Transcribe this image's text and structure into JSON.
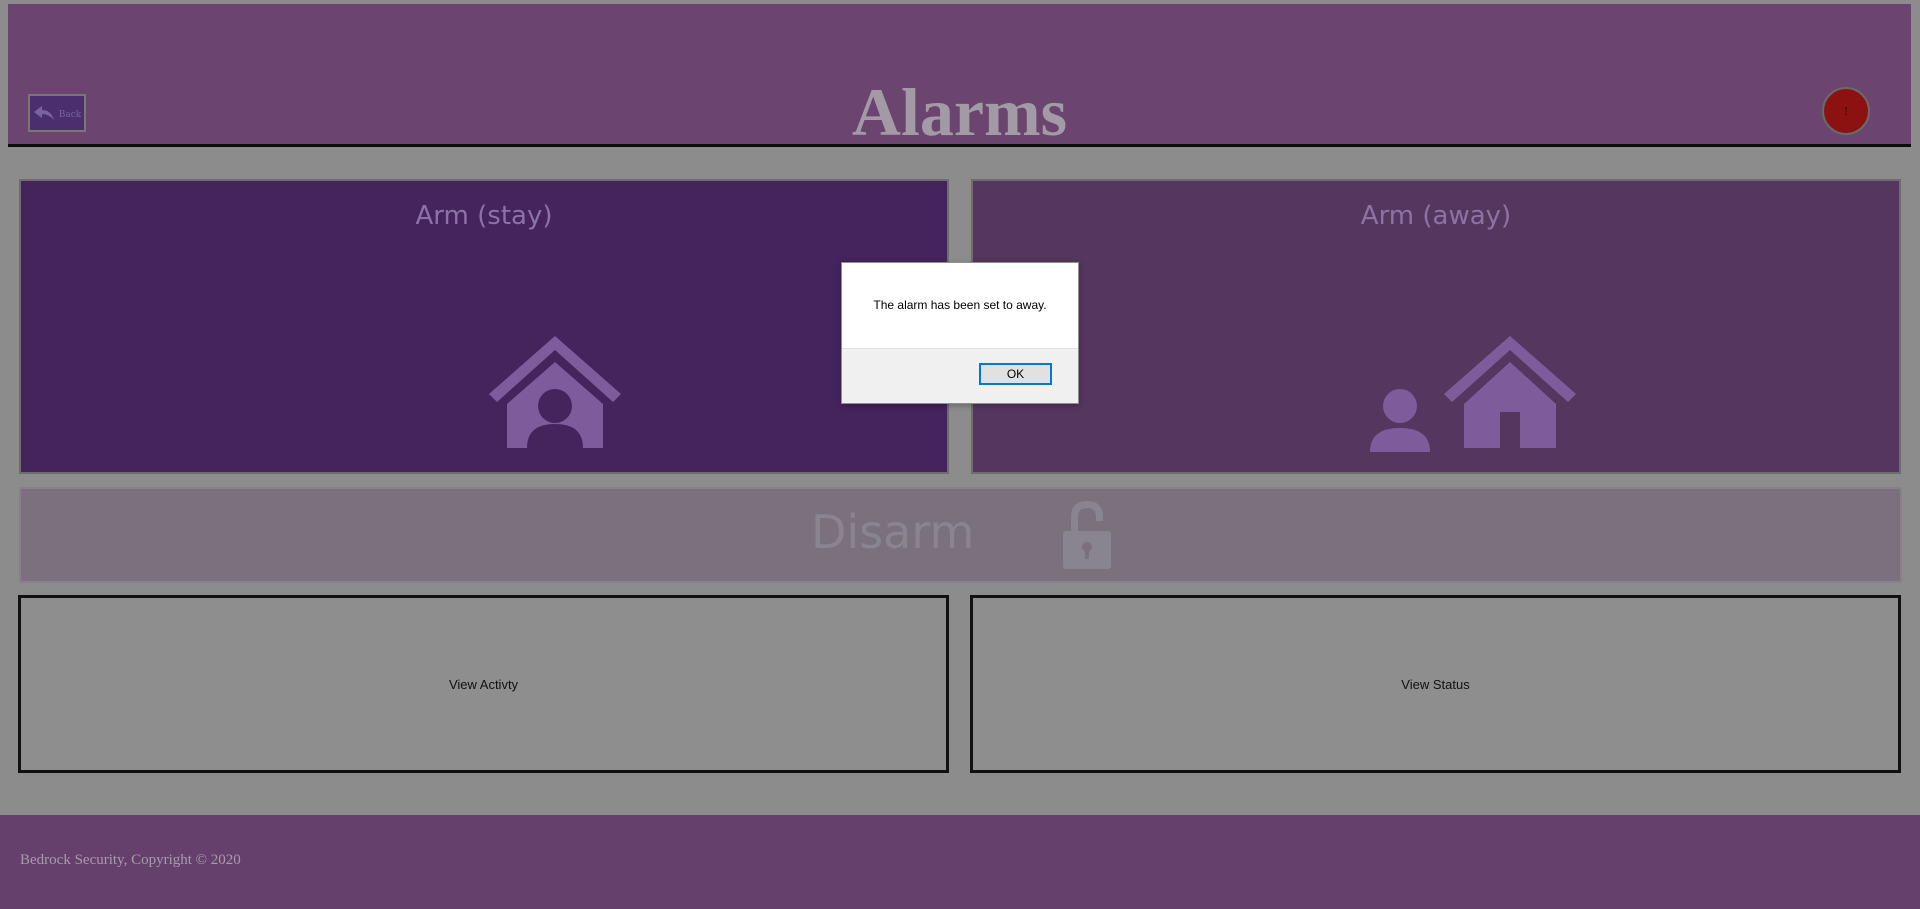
{
  "header": {
    "title": "Alarms",
    "back_label": "Back",
    "alert_label": "!"
  },
  "tiles": {
    "arm_stay": {
      "label": "Arm (stay)",
      "icon": "person-in-house-icon"
    },
    "arm_away": {
      "label": "Arm (away)",
      "icon": "person-away-from-house-icon"
    },
    "disarm": {
      "label": "Disarm",
      "icon": "unlocked-padlock-icon"
    }
  },
  "views": {
    "activity_label": "View Activty",
    "status_label": "View Status"
  },
  "footer": {
    "text": "Bedrock Security, Copyright © 2020"
  },
  "dialog": {
    "message": "The alarm has been set to away.",
    "ok_label": "OK"
  },
  "colors": {
    "header_bg": "#6b446f",
    "arm_stay_bg": "#45235d",
    "arm_away_bg": "#54365f",
    "disarm_bg": "#7a717d",
    "footer_bg": "#66406d",
    "alert_red": "#8c1212",
    "icon_purple": "#7e5c9c"
  }
}
